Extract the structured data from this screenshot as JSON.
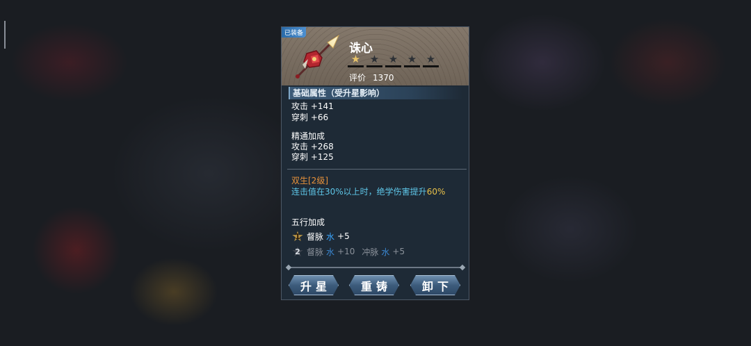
{
  "equipped_tag": "已装备",
  "item": {
    "name": "诛心",
    "stars_total": 5,
    "stars_filled": 1,
    "rating_label": "评价",
    "rating_value": "1370"
  },
  "base_section": {
    "title": "基础属性（受升星影响）",
    "stats": [
      "攻击 +141",
      "穿刺 +66"
    ]
  },
  "mastery": {
    "title": "精通加成",
    "stats": [
      "攻击 +268",
      "穿刺 +125"
    ]
  },
  "skill": {
    "name": "双生[2级]",
    "desc_text": "连击值在30%以上时，绝学伤害提升",
    "desc_highlight": "60%"
  },
  "wuxing": {
    "title": "五行加成",
    "rows": [
      {
        "num": "1",
        "text1": "督脉",
        "element1": "水",
        "value1": "+5"
      },
      {
        "num": "2",
        "text1": "督脉",
        "element1": "水",
        "value1": "+10",
        "text2": "冲脉",
        "element2": "水",
        "value2": "+5"
      }
    ]
  },
  "buttons": {
    "upgrade": "升星",
    "reforge": "重铸",
    "unequip": "卸下"
  },
  "colors": {
    "skill_name": "#e8923a",
    "skill_desc": "#5ec6e8",
    "highlight": "#e8c14a",
    "water": "#3aa6ff",
    "star_on": "#e8c46a"
  }
}
